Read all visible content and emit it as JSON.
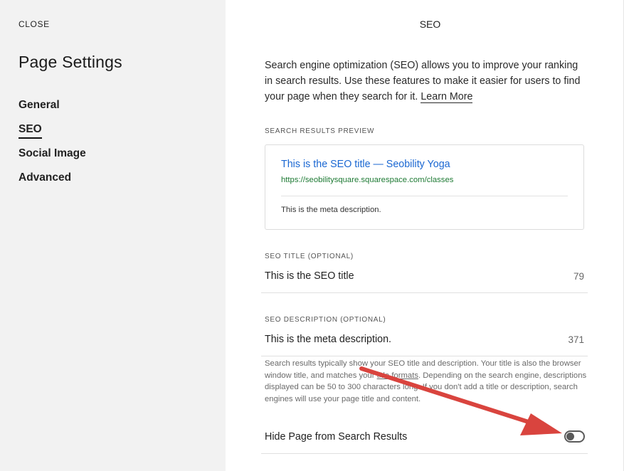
{
  "sidebar": {
    "close_label": "CLOSE",
    "title": "Page Settings",
    "nav": [
      {
        "label": "General",
        "active": false
      },
      {
        "label": "SEO",
        "active": true
      },
      {
        "label": "Social Image",
        "active": false
      },
      {
        "label": "Advanced",
        "active": false
      }
    ]
  },
  "panel": {
    "title": "SEO",
    "intro_text": "Search engine optimization (SEO) allows you to improve your ranking in search results. Use these features to make it easier for users to find your page when they search for it.",
    "learn_more": "Learn More"
  },
  "preview": {
    "label": "SEARCH RESULTS PREVIEW",
    "title": "This is the SEO title — Seobility Yoga",
    "url": "https://seobilitysquare.squarespace.com/classes",
    "description": "This is the meta description."
  },
  "seo_title": {
    "label": "SEO TITLE (OPTIONAL)",
    "value": "This is the SEO title",
    "count": "79"
  },
  "seo_description": {
    "label": "SEO DESCRIPTION (OPTIONAL)",
    "value": "This is the meta description.",
    "count": "371"
  },
  "help": {
    "part1": "Search results typically show your SEO title and description. Your title is also the browser window title, and matches your ",
    "link": "title formats",
    "part2": ". Depending on the search engine, descriptions displayed can be 50 to 300 characters long. If you don't add a title or description, search engines will use your page title and content."
  },
  "hide_page": {
    "label": "Hide Page from Search Results",
    "enabled": false
  },
  "colors": {
    "sidebar_bg": "#f2f2f2",
    "preview_link": "#1a67d2",
    "preview_url": "#1e7a34",
    "annotation_arrow": "#d9443e"
  }
}
